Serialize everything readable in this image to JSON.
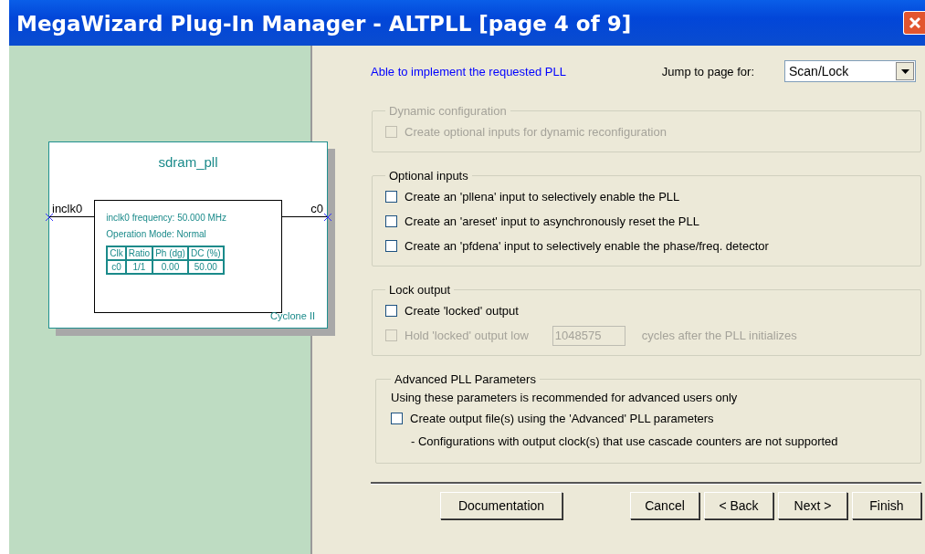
{
  "window": {
    "title": "MegaWizard Plug-In Manager - ALTPLL [page 4 of 9]"
  },
  "diagram": {
    "name": "sdram_pll",
    "input": "inclk0",
    "output": "c0",
    "lines": [
      "inclk0 frequency: 50.000 MHz",
      "Operation Mode: Normal"
    ],
    "table": {
      "columns": [
        "Clk",
        "Ratio",
        "Ph (dg)",
        "DC (%)"
      ],
      "rows": [
        [
          "c0",
          "1/1",
          "0.00",
          "50.00"
        ]
      ]
    },
    "device": "Cyclone II"
  },
  "status": "Able to implement the requested PLL",
  "jump": {
    "label": "Jump to page for:",
    "value": "Scan/Lock"
  },
  "groups": [
    {
      "title": "Dynamic configuration",
      "disabled": true,
      "items": [
        {
          "kind": "checkbox",
          "label": "Create optional inputs for dynamic reconfiguration",
          "checked": false,
          "disabled": true
        }
      ]
    },
    {
      "title": "Optional inputs",
      "disabled": false,
      "items": [
        {
          "kind": "checkbox",
          "label": "Create an 'pllena' input to selectively enable the PLL",
          "checked": false,
          "disabled": false
        },
        {
          "kind": "checkbox",
          "label": "Create an 'areset' input to asynchronously reset the PLL",
          "checked": false,
          "disabled": false
        },
        {
          "kind": "checkbox",
          "label": "Create an 'pfdena' input to selectively enable the phase/freq. detector",
          "checked": false,
          "disabled": false
        }
      ]
    },
    {
      "title": "Lock output",
      "disabled": false,
      "items": [
        {
          "kind": "checkbox",
          "label": "Create 'locked' output",
          "checked": false,
          "disabled": false
        },
        {
          "kind": "checkbox_field",
          "label": "Hold 'locked' output low",
          "checked": false,
          "disabled": true,
          "value": "1048575",
          "suffix": "cycles after the PLL initializes"
        }
      ]
    },
    {
      "title": "Advanced PLL Parameters",
      "disabled": false,
      "items": [
        {
          "kind": "text",
          "label": "Using these parameters is recommended for advanced users only"
        },
        {
          "kind": "checkbox",
          "label": "Create output file(s) using the 'Advanced' PLL parameters",
          "checked": false,
          "disabled": false
        },
        {
          "kind": "note",
          "label": "- Configurations with output clock(s) that use cascade counters are not supported"
        }
      ]
    }
  ],
  "help_button": "Documentation",
  "nav_buttons": [
    "Cancel",
    "< Back",
    "Next >",
    "Finish"
  ]
}
